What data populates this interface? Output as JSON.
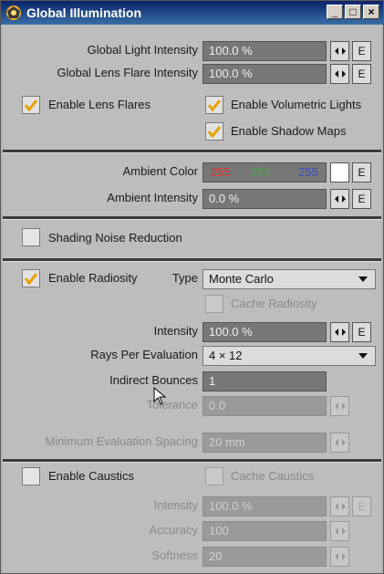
{
  "window": {
    "title": "Global Illumination",
    "min": "_",
    "max": "□",
    "close": "×"
  },
  "gl": {
    "label": "Global Light Intensity",
    "value": "100.0 %"
  },
  "lf": {
    "label": "Global Lens Flare Intensity",
    "value": "100.0 %"
  },
  "btn_e": "E",
  "lens_flares": "Enable Lens Flares",
  "volumetric": "Enable Volumetric Lights",
  "shadow_maps": "Enable Shadow Maps",
  "ambient": {
    "label": "Ambient Color",
    "r": "255",
    "g": "255",
    "b": "255",
    "r_color": "#e03030",
    "g_color": "#4fa04f",
    "b_color": "#3a4fc8"
  },
  "amb_int": {
    "label": "Ambient Intensity",
    "value": "0.0 %"
  },
  "noise": "Shading Noise Reduction",
  "radiosity": {
    "label": "Enable Radiosity",
    "type_label": "Type",
    "type_value": "Monte Carlo",
    "cache": "Cache Radiosity",
    "int_label": "Intensity",
    "int_value": "100.0 %",
    "rays_label": "Rays Per Evaluation",
    "rays_value": "4 × 12",
    "bounces_label": "Indirect Bounces",
    "bounces_value": "1",
    "tol_label": "Tolerance",
    "tol_value": "0.0",
    "spacing_label": "Minimum Evaluation Spacing",
    "spacing_value": "20 mm"
  },
  "caustics": {
    "label": "Enable Caustics",
    "cache": "Cache Caustics",
    "int_label": "Intensity",
    "int_value": "100.0 %",
    "acc_label": "Accuracy",
    "acc_value": "100",
    "soft_label": "Softness",
    "soft_value": "20"
  },
  "icons": {
    "app": "lightwave-app-icon",
    "lr": "left-right-arrows-icon",
    "check": "checkmark-icon"
  }
}
